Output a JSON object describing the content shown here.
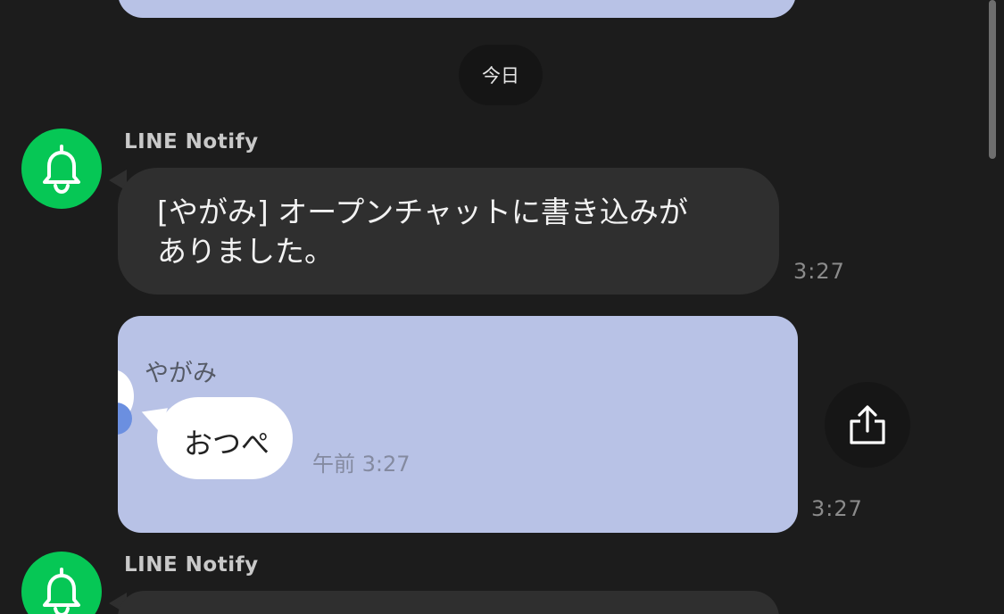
{
  "date_divider": "今日",
  "messages": [
    {
      "sender": "LINE Notify",
      "text": "[やがみ] オープンチャットに書き込みが\nありました。",
      "time": "3:27"
    },
    {
      "image": {
        "name": "やがみ",
        "speech": "おつぺ",
        "time": "午前 3:27"
      },
      "time": "3:27"
    },
    {
      "sender": "LINE Notify"
    }
  ],
  "icons": {
    "avatar": "bell-icon",
    "share": "share-icon"
  },
  "colors": {
    "background": "#1c1c1c",
    "avatar_green": "#06c755",
    "bubble": "#2f2f2f",
    "image_bg": "#b8c2e6"
  }
}
